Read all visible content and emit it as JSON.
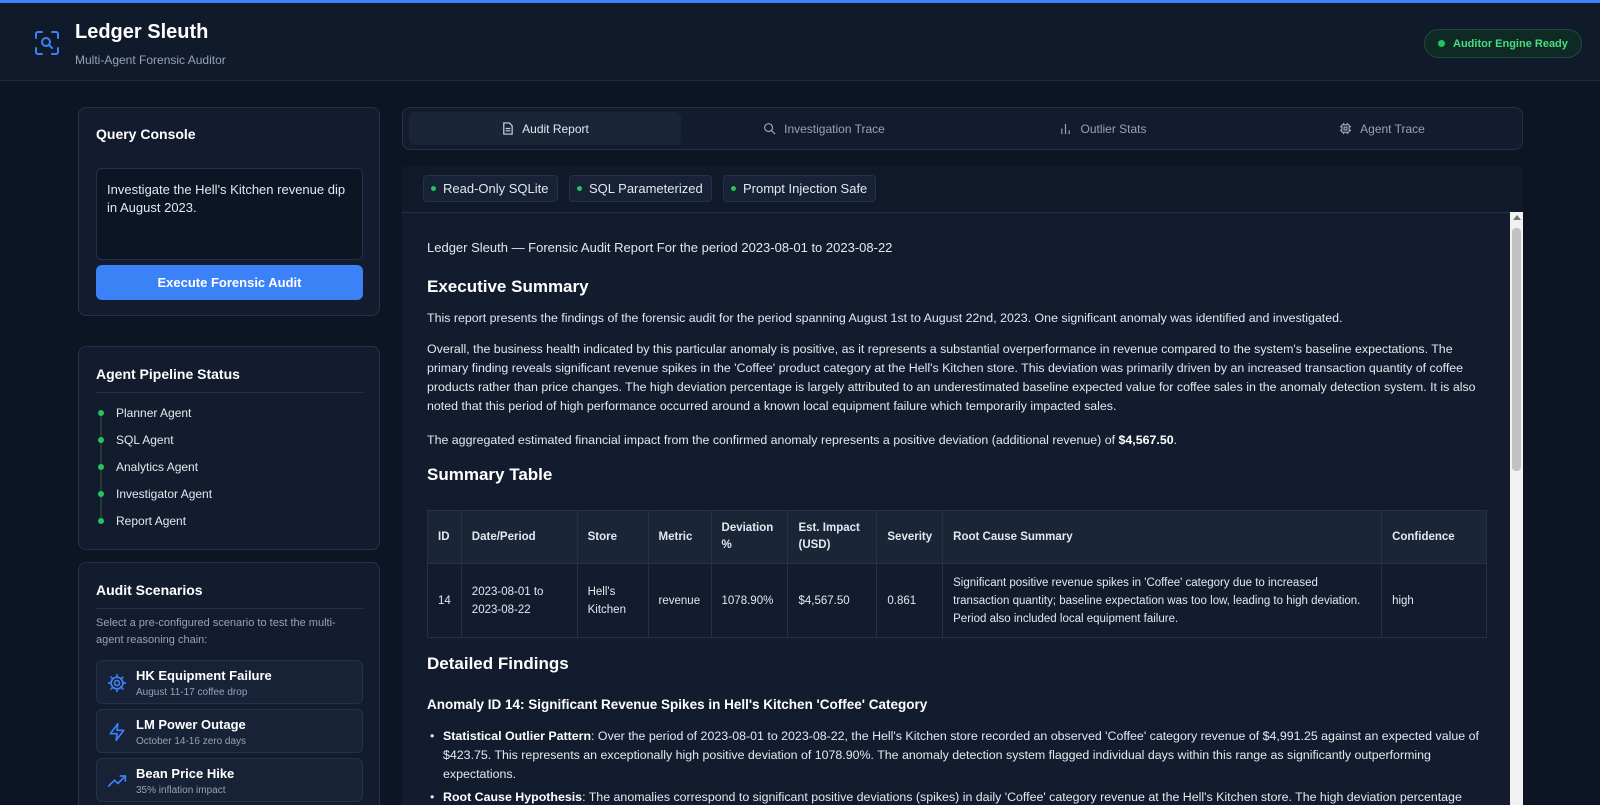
{
  "app": {
    "title": "Ledger Sleuth",
    "subtitle": "Multi-Agent Forensic Auditor",
    "status": "Auditor Engine Ready"
  },
  "query_console": {
    "title": "Query Console",
    "query": "Investigate the Hell's Kitchen revenue dip in August 2023.",
    "execute_label": "Execute Forensic Audit"
  },
  "pipeline": {
    "title": "Agent Pipeline Status",
    "stages": [
      "Planner Agent",
      "SQL Agent",
      "Analytics Agent",
      "Investigator Agent",
      "Report Agent"
    ]
  },
  "scenarios": {
    "title": "Audit Scenarios",
    "description": "Select a pre-configured scenario to test the multi-agent reasoning chain:",
    "items": [
      {
        "name": "HK Equipment Failure",
        "sub": "August 11-17 coffee drop",
        "icon": "gear-icon"
      },
      {
        "name": "LM Power Outage",
        "sub": "October 14-16 zero days",
        "icon": "lightning-icon"
      },
      {
        "name": "Bean Price Hike",
        "sub": "35% inflation impact",
        "icon": "trend-up-icon"
      }
    ]
  },
  "tabs": [
    {
      "label": "Audit Report",
      "icon": "document-icon",
      "active": true
    },
    {
      "label": "Investigation Trace",
      "icon": "search-icon",
      "active": false
    },
    {
      "label": "Outlier Stats",
      "icon": "bar-chart-icon",
      "active": false
    },
    {
      "label": "Agent Trace",
      "icon": "chip-icon",
      "active": false
    }
  ],
  "security_badges": [
    "Read-Only SQLite",
    "SQL Parameterized",
    "Prompt Injection Safe"
  ],
  "report": {
    "header": "Ledger Sleuth — Forensic Audit Report For the period 2023-08-01 to 2023-08-22",
    "exec_title": "Executive Summary",
    "exec_p1": "This report presents the findings of the forensic audit for the period spanning August 1st to August 22nd, 2023. One significant anomaly was identified and investigated.",
    "exec_p2": "Overall, the business health indicated by this particular anomaly is positive, as it represents a substantial overperformance in revenue compared to the system's baseline expectations. The primary finding reveals significant revenue spikes in the 'Coffee' product category at the Hell's Kitchen store. This deviation was primarily driven by an increased transaction quantity of coffee products rather than price changes. The high deviation percentage is largely attributed to an underestimated baseline expected value for coffee sales in the anomaly detection system. It is also noted that this period of high performance occurred around a known local equipment failure which temporarily impacted sales.",
    "exec_p3_prefix": "The aggregated estimated financial impact from the confirmed anomaly represents a positive deviation (additional revenue) of ",
    "exec_p3_amount": "$4,567.50",
    "exec_p3_suffix": ".",
    "table_title": "Summary Table",
    "table_headers": [
      "ID",
      "Date/Period",
      "Store",
      "Metric",
      "Deviation %",
      "Est. Impact (USD)",
      "Severity",
      "Root Cause Summary",
      "Confidence"
    ],
    "table_rows": [
      [
        "14",
        "2023-08-01 to 2023-08-22",
        "Hell's Kitchen",
        "revenue",
        "1078.90%",
        "$4,567.50",
        "0.861",
        "Significant positive revenue spikes in 'Coffee' category due to increased transaction quantity; baseline expectation was too low, leading to high deviation. Period also included local equipment failure.",
        "high"
      ]
    ],
    "findings_title": "Detailed Findings",
    "anomaly_title": "Anomaly ID 14: Significant Revenue Spikes in Hell's Kitchen 'Coffee' Category",
    "bullets": [
      {
        "label": "Statistical Outlier Pattern",
        "text": ": Over the period of 2023-08-01 to 2023-08-22, the Hell's Kitchen store recorded an observed 'Coffee' category revenue of $4,991.25 against an expected value of $423.75. This represents an exceptionally high positive deviation of 1078.90%. The anomaly detection system flagged individual days within this range as significantly outperforming expectations."
      },
      {
        "label": "Root Cause Hypothesis",
        "text": ": The anomalies correspond to significant positive deviations (spikes) in daily 'Coffee' category revenue at the Hell's Kitchen store. The high deviation percentage"
      }
    ]
  }
}
